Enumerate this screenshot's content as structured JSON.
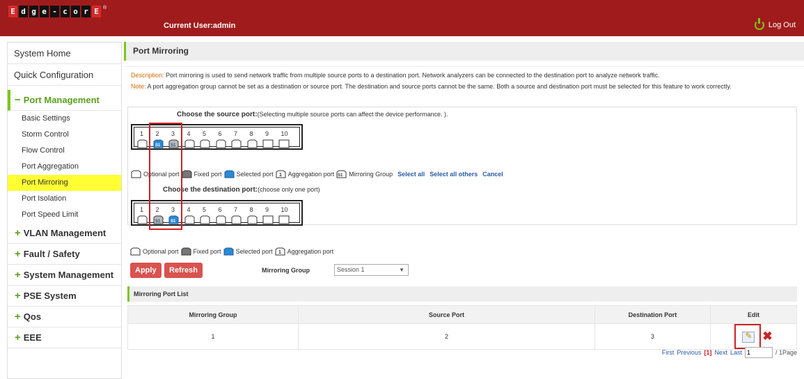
{
  "header": {
    "logo_letters": [
      "E",
      "d",
      "g",
      "e",
      "-",
      "c",
      "o",
      "r",
      "E"
    ],
    "current_user": "Current User:admin",
    "logout": "Log Out"
  },
  "sidebar": {
    "top_items": [
      "System Home",
      "Quick Configuration"
    ],
    "open_group": "Port Management",
    "sub_items": [
      "Basic Settings",
      "Storm Control",
      "Flow Control",
      "Port Aggregation",
      "Port Mirroring",
      "Port Isolation",
      "Port Speed Limit"
    ],
    "active_sub": "Port Mirroring",
    "groups": [
      "VLAN Management",
      "Fault / Safety",
      "System Management",
      "PSE System",
      "Qos",
      "EEE"
    ]
  },
  "main": {
    "title": "Port Mirroring",
    "description_label": "Description:",
    "description": "Port mirroring is used to send network traffic from multiple source ports to a destination port. Network analyzers can be connected to the destination port to analyze network traffic.",
    "note_label": "Note:",
    "note": "A port aggregation group cannot be set as a destination or source port. The destination and source ports cannot be the same. Both a source and destination port must be selected for this feature to work correctly.",
    "source_title": "Choose the source port:",
    "source_note": "(Selecting multiple source ports can affect the device performance. ).",
    "dest_title": "Choose the destination port:",
    "dest_note": "(choose only one port)",
    "port_numbers": [
      "1",
      "2",
      "3",
      "4",
      "5",
      "6",
      "7",
      "8",
      "9",
      "10"
    ],
    "legend1": {
      "optional": "Optional port",
      "fixed": "Fixed port",
      "selected": "Selected port",
      "aggregation": "Aggregation port",
      "mirroring": "Mirroring Group",
      "select_all": "Select all",
      "select_others": "Select all others",
      "cancel": "Cancel"
    },
    "legend2": {
      "optional": "Optional port",
      "fixed": "Fixed port",
      "selected": "Selected port",
      "aggregation": "Aggregation port"
    },
    "apply": "Apply",
    "refresh": "Refresh",
    "mirroring_group_label": "Mirroring Group",
    "mirroring_group_value": "Session 1"
  },
  "list": {
    "title": "Mirroring Port List",
    "columns": [
      "Mirroring Group",
      "Source Port",
      "Destination Port",
      "Edit"
    ],
    "rows": [
      {
        "group": "1",
        "source": "2",
        "dest": "3"
      }
    ],
    "pager": {
      "first": "First",
      "previous": "Previous",
      "current": "[1]",
      "next": "Next",
      "last": "Last",
      "input": "1",
      "total": "/ 1Page"
    }
  },
  "colors": {
    "header_bg": "#a01c1c",
    "accent_green": "#7bc71b",
    "active_yellow": "#ffff33",
    "link_blue": "#2a5aa8",
    "button_red": "#d9534f"
  }
}
